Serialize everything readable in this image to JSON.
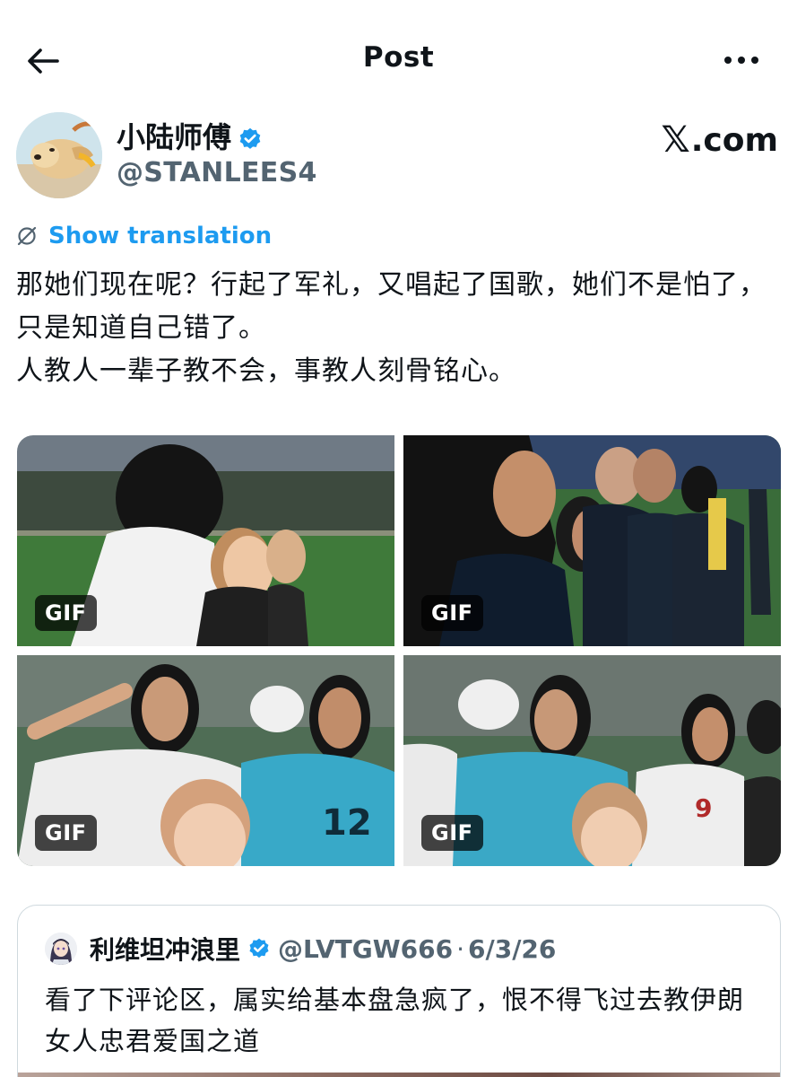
{
  "topbar": {
    "title": "Post"
  },
  "author": {
    "display_name": "小陆师傅",
    "handle": "@STANLEES4",
    "verified": true
  },
  "brand": {
    "x_glyph": "𝕏",
    "suffix": ".com"
  },
  "translation": {
    "label": "Show translation"
  },
  "post": {
    "text": "那她们现在呢？行起了军礼，又唱起了国歌，她们不是怕了，只是知道自己错了。\n人教人一辈子教不会，事教人刻骨铭心。"
  },
  "media": [
    {
      "badge": "GIF"
    },
    {
      "badge": "GIF"
    },
    {
      "badge": "GIF"
    },
    {
      "badge": "GIF"
    }
  ],
  "quote": {
    "name": "利维坦冲浪里",
    "handle": "@LVTGW666",
    "separator": "·",
    "date": "6/3/26",
    "text": "看了下评论区，属实给基本盘急疯了，恨不得飞过去教伊朗女人忠君爱国之道"
  },
  "colors": {
    "accent": "#1d9bf0",
    "secondary_text": "#536471",
    "border": "#cfd9de"
  }
}
